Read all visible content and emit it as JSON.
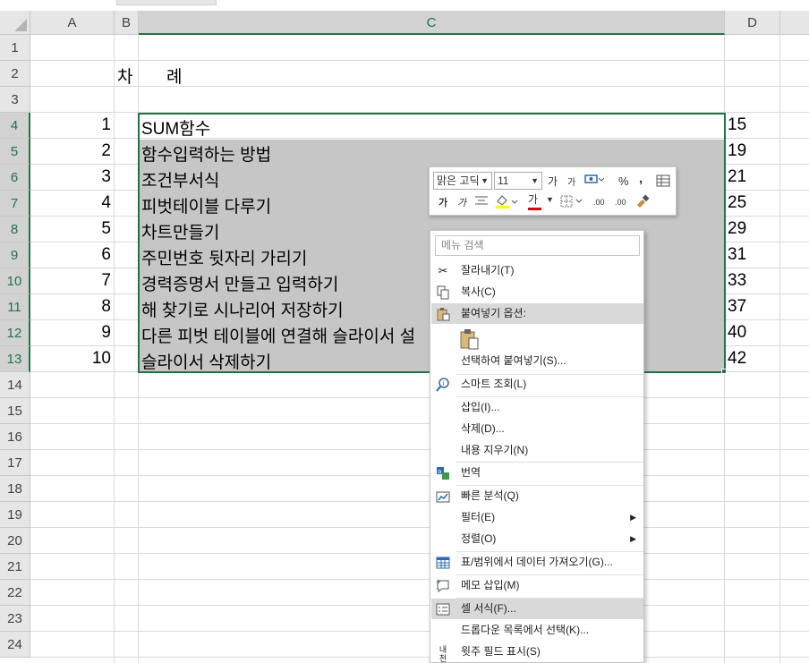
{
  "columns": [
    "A",
    "B",
    "C",
    "D"
  ],
  "rows": [
    "1",
    "2",
    "3",
    "4",
    "5",
    "6",
    "7",
    "8",
    "9",
    "10",
    "11",
    "12",
    "13",
    "14",
    "15",
    "16",
    "17",
    "18",
    "19",
    "20",
    "21",
    "22",
    "23",
    "24"
  ],
  "toc": {
    "title_a": "차",
    "title_b": "례",
    "entries": [
      {
        "num": "1",
        "title": "SUM함수",
        "page": "15"
      },
      {
        "num": "2",
        "title": "함수입력하는 방법",
        "page": "19"
      },
      {
        "num": "3",
        "title": "조건부서식",
        "page": "21"
      },
      {
        "num": "4",
        "title": "피벗테이블 다루기",
        "page": "25"
      },
      {
        "num": "5",
        "title": "차트만들기",
        "page": "29"
      },
      {
        "num": "6",
        "title": "주민번호 뒷자리 가리기",
        "page": "31"
      },
      {
        "num": "7",
        "title": "경력증명서 만들고 입력하기",
        "page": "33"
      },
      {
        "num": "8",
        "title": "해 찾기로 시나리어 저장하기",
        "page": "37"
      },
      {
        "num": "9",
        "title": "다른 피벗 테이블에 연결해 슬라이서 설",
        "page": "40"
      },
      {
        "num": "10",
        "title": "슬라이서 삭제하기",
        "page": "42"
      }
    ]
  },
  "mini_toolbar": {
    "font_name": "맑은 고딕",
    "font_size": "11",
    "grow_font": "가",
    "shrink_font": "가",
    "percent": "%",
    "comma": ",",
    "bold": "가",
    "italic": "가",
    "font_color_glyph": "가",
    "inc_decimal": ".00",
    "dec_decimal": ".00"
  },
  "context_menu": {
    "search_placeholder": "메뉴 검색",
    "cut": "잘라내기(T)",
    "copy": "복사(C)",
    "paste_options": "붙여넣기 옵션:",
    "paste_special": "선택하여 붙여넣기(S)...",
    "smart_lookup": "스마트 조회(L)",
    "insert": "삽입(I)...",
    "delete": "삭제(D)...",
    "clear_contents": "내용 지우기(N)",
    "translate": "번역",
    "quick_analysis": "빠른 분석(Q)",
    "filter": "필터(E)",
    "sort": "정렬(O)",
    "get_data": "표/범위에서 데이터 가져오기(G)...",
    "insert_comment": "메모 삽입(M)",
    "format_cells": "셀 서식(F)...",
    "pick_from_list": "드롭다운 목록에서 선택(K)...",
    "phonetic": "윗주 필드 표시(S)",
    "phonetic_icon_text": "내천"
  },
  "colors": {
    "accent_green": "#217346",
    "selection_fill": "#c6c6c6",
    "menu_highlight": "#d9d9d9"
  }
}
